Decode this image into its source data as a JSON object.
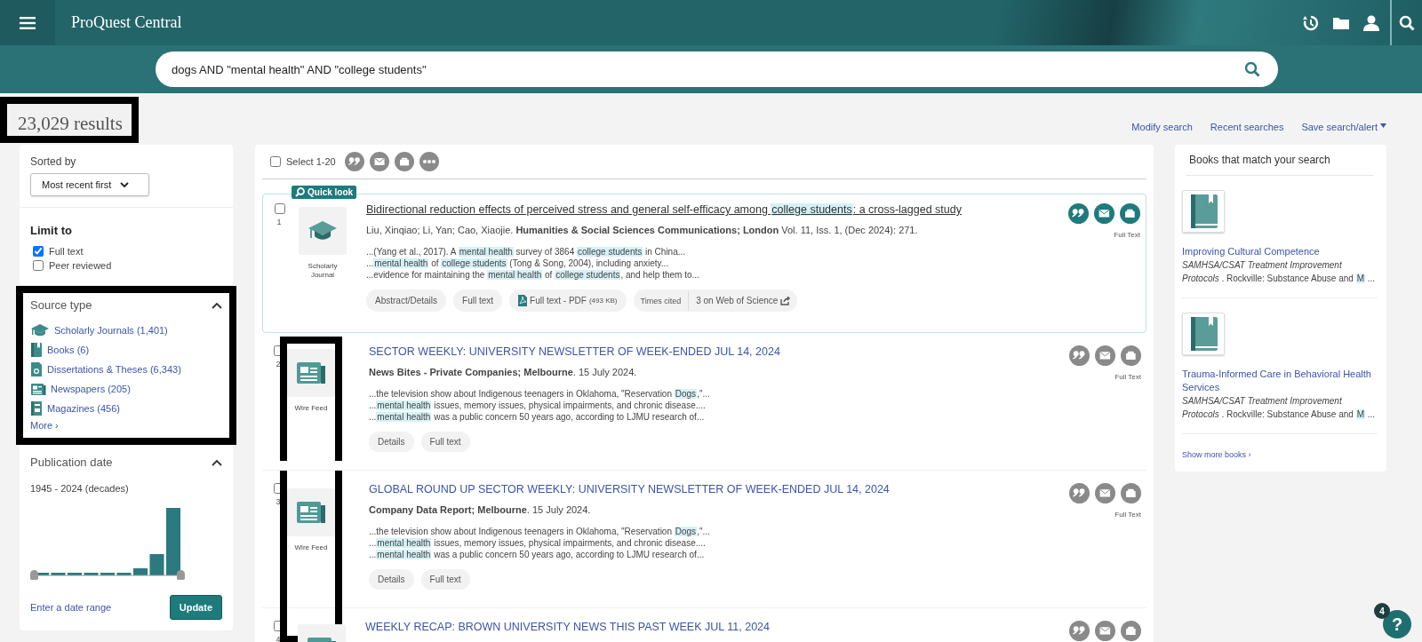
{
  "header": {
    "brand": "ProQuest Central"
  },
  "search": {
    "value": "dogs AND \"mental health\" AND \"college students\""
  },
  "results_count": {
    "text": "23,029 results",
    "highlighted": true
  },
  "top_links": [
    {
      "label": "Modify search",
      "dropdown": false
    },
    {
      "label": "Recent searches",
      "dropdown": false
    },
    {
      "label": "Save search/alert",
      "dropdown": true
    }
  ],
  "sort": {
    "label": "Sorted by",
    "value": "Most recent first"
  },
  "limit_to": {
    "title": "Limit to",
    "options": [
      {
        "label": "Full text",
        "checked": true
      },
      {
        "label": "Peer reviewed",
        "checked": false
      }
    ]
  },
  "source_type": {
    "title": "Source type",
    "expanded": true,
    "highlighted": true,
    "items": [
      {
        "kind": "journal",
        "label": "Scholarly Journals (1,401)"
      },
      {
        "kind": "book",
        "label": "Books (6)"
      },
      {
        "kind": "thesis",
        "label": "Dissertations & Theses (6,343)"
      },
      {
        "kind": "newspaper",
        "label": "Newspapers (205)"
      },
      {
        "kind": "magazine",
        "label": "Magazines (456)"
      }
    ],
    "more": "More ›"
  },
  "publication_date": {
    "title": "Publication date",
    "expanded": true,
    "range": "1945 - 2024 (decades)",
    "date_range_link": "Enter a date range",
    "update": "Update"
  },
  "select_all": {
    "label": "Select 1-20",
    "checked": false
  },
  "results": [
    {
      "number": "1",
      "checked": false,
      "quick_look": "Quick look",
      "kind": "journal",
      "type_label": "Scholarly Journal",
      "thumb_highlighted": false,
      "featured": true,
      "title": [
        {
          "text": "Bidirectional reduction effects of perceived stress and general self-efficacy among ",
          "hit": false
        },
        {
          "text": "college students",
          "hit": true
        },
        {
          "text": ": a cross-lagged study",
          "hit": false
        }
      ],
      "citation": "Liu, Xinqiao; Li, Yan; Cao, Xiaojie.  **Humanities & Social Sciences Communications; London** Vol. 11, Iss. 1,  (Dec 2024): 271.",
      "snippets": [
        [
          {
            "text": "...(Yang et al., 2017). A ",
            "hit": false
          },
          {
            "text": "mental health",
            "hit": true
          },
          {
            "text": " survey of 3864 ",
            "hit": false
          },
          {
            "text": "college students",
            "hit": true
          },
          {
            "text": " in China...",
            "hit": false
          }
        ],
        [
          {
            "text": "...",
            "hit": false
          },
          {
            "text": "mental health",
            "hit": true
          },
          {
            "text": " of ",
            "hit": false
          },
          {
            "text": "college students",
            "hit": true
          },
          {
            "text": " (Tong & Song, 2004), including anxiety...",
            "hit": false
          }
        ],
        [
          {
            "text": "...evidence for maintaining the ",
            "hit": false
          },
          {
            "text": "mental health",
            "hit": true
          },
          {
            "text": " of ",
            "hit": false
          },
          {
            "text": "college students",
            "hit": true
          },
          {
            "text": ", and help them to...",
            "hit": false
          }
        ]
      ],
      "actions": [
        {
          "kind": "plain",
          "label": "Abstract/Details"
        },
        {
          "kind": "plain",
          "label": "Full text"
        },
        {
          "kind": "pdf",
          "label": "Full text - PDF",
          "size": "(493 KB)"
        },
        {
          "kind": "cited",
          "label": "Times cited",
          "link": "3 on Web of Science"
        }
      ],
      "tools_active": true,
      "availability": "Full Text"
    },
    {
      "number": "2",
      "checked": false,
      "kind": "wire",
      "type_label": "Wire Feed",
      "thumb_highlighted": true,
      "featured": false,
      "title": [
        {
          "text": "SECTOR WEEKLY: UNIVERSITY NEWSLETTER OF WEEK-ENDED JUL 14, 2024",
          "hit": false
        }
      ],
      "citation": "**News Bites - Private Companies; Melbourne**. 15 July 2024.",
      "snippets": [
        [
          {
            "text": "...the television show about Indigenous teenagers in Oklahoma, \"Reservation ",
            "hit": false
          },
          {
            "text": "Dogs",
            "hit": true
          },
          {
            "text": ",\"...",
            "hit": false
          }
        ],
        [
          {
            "text": "...",
            "hit": false
          },
          {
            "text": "mental health",
            "hit": true
          },
          {
            "text": " issues, memory issues, physical impairments, and chronic disease....",
            "hit": false
          }
        ],
        [
          {
            "text": "...",
            "hit": false
          },
          {
            "text": "mental health",
            "hit": true
          },
          {
            "text": " was a public concern 50 years ago, according to LJMU research of...",
            "hit": false
          }
        ]
      ],
      "actions": [
        {
          "kind": "plain",
          "label": "Details"
        },
        {
          "kind": "plain",
          "label": "Full text"
        }
      ],
      "tools_active": false,
      "availability": "Full Text"
    },
    {
      "number": "3",
      "checked": false,
      "kind": "wire",
      "type_label": "Wire Feed",
      "thumb_highlighted": true,
      "featured": false,
      "title": [
        {
          "text": "GLOBAL ROUND UP SECTOR WEEKLY: UNIVERSITY NEWSLETTER OF WEEK-ENDED JUL 14, 2024",
          "hit": false
        }
      ],
      "citation": "**Company Data Report; Melbourne**. 15 July 2024.",
      "snippets": [
        [
          {
            "text": "...the television show about Indigenous teenagers in Oklahoma, \"Reservation ",
            "hit": false
          },
          {
            "text": "Dogs",
            "hit": true
          },
          {
            "text": ",\"...",
            "hit": false
          }
        ],
        [
          {
            "text": "...",
            "hit": false
          },
          {
            "text": "mental health",
            "hit": true
          },
          {
            "text": " issues, memory issues, physical impairments, and chronic disease....",
            "hit": false
          }
        ],
        [
          {
            "text": "...",
            "hit": false
          },
          {
            "text": "mental health",
            "hit": true
          },
          {
            "text": " was a public concern 50 years ago, according to LJMU research of...",
            "hit": false
          }
        ]
      ],
      "actions": [
        {
          "kind": "plain",
          "label": "Details"
        },
        {
          "kind": "plain",
          "label": "Full text"
        }
      ],
      "tools_active": false,
      "availability": "Full Text"
    },
    {
      "number": "4",
      "checked": false,
      "kind": "wire",
      "thumb_highlighted": false,
      "featured": false,
      "title": [
        {
          "text": "WEEKLY RECAP: BROWN UNIVERSITY NEWS THIS PAST WEEK JUL 11, 2024",
          "hit": false
        }
      ],
      "tools_active": false
    }
  ],
  "books": {
    "title": "Books that match your search",
    "items": [
      {
        "title": "Improving Cultural Competence",
        "series": "SAMHSA/CSAT Treatment Improvement Protocols",
        "place": " . Rockville: Substance Abuse and ",
        "hit": "M",
        "tail": " ..."
      },
      {
        "title": "Trauma-Informed Care in Behavioral Health Services",
        "series": "SAMHSA/CSAT Treatment Improvement Protocols",
        "place": " . Rockville: Substance Abuse and ",
        "hit": "M",
        "tail": " ..."
      }
    ],
    "more": "Show more books ›"
  },
  "help": {
    "icon": "?",
    "badge": "4"
  }
}
